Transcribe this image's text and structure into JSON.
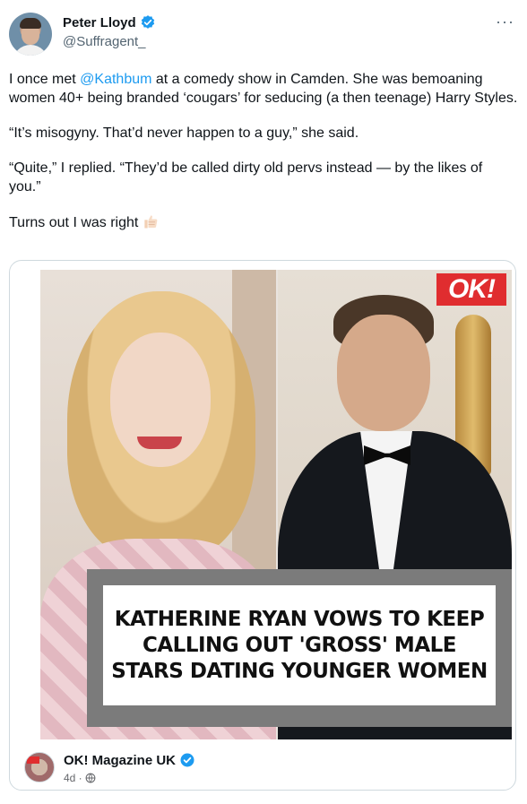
{
  "author": {
    "display_name": "Peter Lloyd",
    "handle": "@Suffragent_",
    "avatar_icon": "profile-photo"
  },
  "tweet": {
    "line1_before": "I once met ",
    "line1_mention": "@Kathbum",
    "line1_after": " at a comedy show in Camden. She was bemoaning women 40+ being branded ‘cougars’ for seducing (a then teenage) Harry Styles.",
    "para2": "“It’s misogyny. That’d never happen to a guy,” she said.",
    "para3": "“Quite,” I replied. “They’d be called dirty old pervs instead — by the likes of you.”",
    "para4": "Turns out I was right",
    "emoji_icon": "thumbs-up-icon"
  },
  "card": {
    "logo": "OK!",
    "headline": "KATHERINE RYAN VOWS TO KEEP CALLING OUT 'GROSS' MALE STARS DATING YOUNGER WOMEN",
    "source_name": "OK! Magazine UK",
    "source_meta": "4d ·",
    "visibility_icon": "globe-icon"
  },
  "colors": {
    "link_blue": "#1d9bf0",
    "verified_blue": "#1d9bf0",
    "ok_red": "#e02d2f"
  }
}
